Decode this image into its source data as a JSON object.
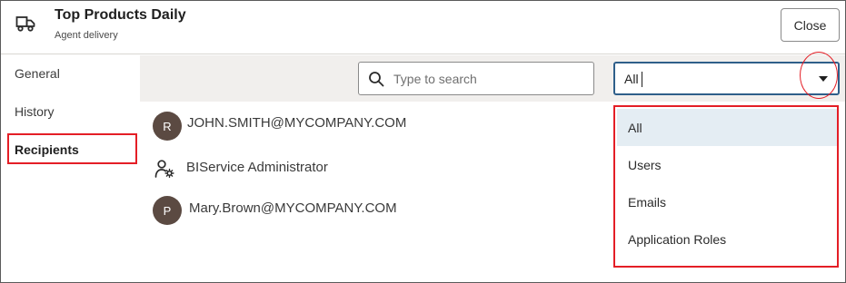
{
  "header": {
    "title": "Top Products Daily",
    "subtitle": "Agent delivery",
    "close_label": "Close",
    "icon": "truck-icon"
  },
  "nav": {
    "items": [
      {
        "label": "General",
        "active": false
      },
      {
        "label": "History",
        "active": false
      },
      {
        "label": "Recipients",
        "active": true
      }
    ]
  },
  "search": {
    "placeholder": "Type to search",
    "value": ""
  },
  "filter": {
    "value": "All",
    "options": [
      "All",
      "Users",
      "Emails",
      "Application Roles"
    ],
    "selected_index": 0
  },
  "recipients": [
    {
      "initial": "R",
      "name": "JOHN.SMITH@MYCOMPANY.COM",
      "icon": "avatar"
    },
    {
      "initial": "",
      "name": "BIService Administrator",
      "icon": "application-role-icon"
    },
    {
      "initial": "P",
      "name": "Mary.Brown@MYCOMPANY.COM",
      "icon": "avatar"
    }
  ],
  "colors": {
    "highlight": "#e41e26",
    "select_border": "#2f5f8a",
    "avatar_bg": "#5b4a42",
    "toolbar_bg": "#f1efed",
    "selected_option_bg": "#e4edf3"
  }
}
